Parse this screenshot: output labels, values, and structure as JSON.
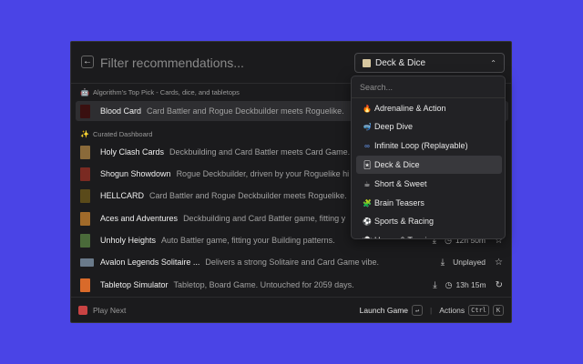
{
  "header": {
    "back_icon": "arrow-left-icon",
    "filter_placeholder": "Filter recommendations...",
    "selected_category": "Deck & Dice",
    "selected_icon": "cards-icon"
  },
  "sections": {
    "top_pick_label": "Algorithm's Top Pick - Cards, dice, and tabletops",
    "top_pick_icon": "robot-icon",
    "curated_label": "Curated Dashboard",
    "curated_icon": "sparkle-icon"
  },
  "games": [
    {
      "title": "Blood Card",
      "desc": "Card Battler and Rogue Deckbuilder meets Roguelike.",
      "thumb_color": "#3a1010"
    },
    {
      "title": "Holy Clash Cards",
      "desc": "Deckbuilding and Card Battler meets Card Game.",
      "thumb_color": "#8a6a3a"
    },
    {
      "title": "Shogun Showdown",
      "desc": "Rogue Deckbuilder, driven by your Roguelike hi",
      "thumb_color": "#7a2a22"
    },
    {
      "title": "HELLCARD",
      "desc": "Card Battler and Rogue Deckbuilder meets Roguelike.",
      "thumb_color": "#5a4a1a"
    },
    {
      "title": "Aces and Adventures",
      "desc": "Deckbuilding and Card Battler game, fitting y",
      "thumb_color": "#a06a2a"
    },
    {
      "title": "Unholy Heights",
      "desc": "Auto Battler game, fitting your Building patterns.",
      "thumb_color": "#4a6a3a",
      "meta": "12h 50m",
      "meta_icon": "clock-icon",
      "tail_icon": "star-icon"
    },
    {
      "title": "Avalon Legends Solitaire ...",
      "desc": "Delivers a strong Solitaire and Card Game vibe.",
      "thumb_color": "#6a7a8a",
      "meta": "Unplayed",
      "tail_icon": "star-icon"
    },
    {
      "title": "Tabletop Simulator",
      "desc": "Tabletop, Board Game. Untouched for 2059 days.",
      "thumb_color": "#d96a2a",
      "meta": "13h 15m",
      "meta_icon": "clock-icon",
      "tail_icon": "refresh-icon"
    }
  ],
  "dropdown": {
    "search_placeholder": "Search...",
    "items": [
      {
        "label": "Adrenaline & Action",
        "icon": "fire-icon",
        "glyph": "🔥"
      },
      {
        "label": "Deep Dive",
        "icon": "diver-icon",
        "glyph": "🤿"
      },
      {
        "label": "Infinite Loop (Replayable)",
        "icon": "infinity-icon",
        "glyph": "∞"
      },
      {
        "label": "Deck & Dice",
        "icon": "cards-icon",
        "glyph": "🃏"
      },
      {
        "label": "Short & Sweet",
        "icon": "cup-icon",
        "glyph": "☕"
      },
      {
        "label": "Brain Teasers",
        "icon": "puzzle-icon",
        "glyph": "🧩"
      },
      {
        "label": "Sports & Racing",
        "icon": "ball-icon",
        "glyph": "⚽"
      },
      {
        "label": "Horror & Tension",
        "icon": "ghost-icon",
        "glyph": "👻"
      }
    ]
  },
  "footer": {
    "play_next": "Play Next",
    "launch_label": "Launch Game",
    "launch_key": "↵",
    "actions_label": "Actions",
    "actions_key1": "Ctrl",
    "actions_key2": "K"
  },
  "colors": {
    "background": "#4a44e6",
    "window": "#1b1b1d",
    "selected_row": "#2e2e31"
  }
}
